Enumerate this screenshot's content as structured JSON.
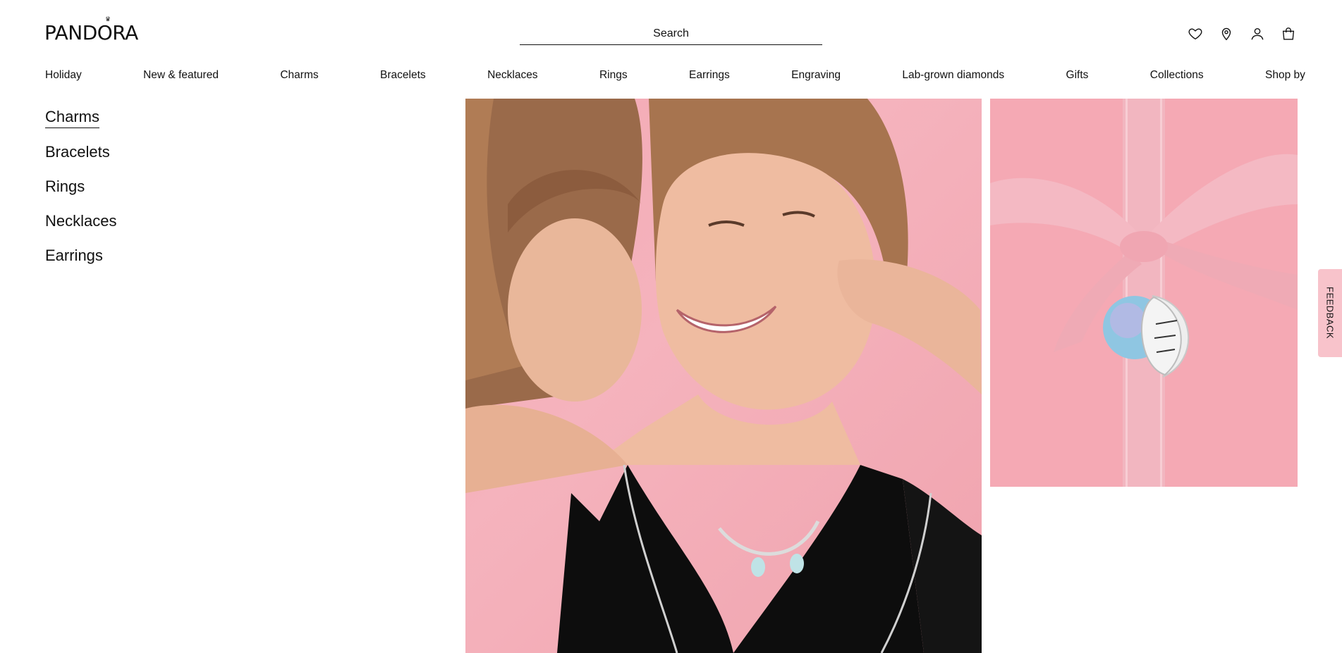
{
  "header": {
    "logo": "PANDORA",
    "search_placeholder": "Search",
    "icons": [
      "heart-icon",
      "location-pin-icon",
      "user-icon",
      "shopping-bag-icon"
    ]
  },
  "nav": {
    "items": [
      "Holiday",
      "New & featured",
      "Charms",
      "Bracelets",
      "Necklaces",
      "Rings",
      "Earrings",
      "Engraving",
      "Lab-grown diamonds",
      "Gifts",
      "Collections",
      "Shop by"
    ]
  },
  "submenu": {
    "items": [
      "Charms",
      "Bracelets",
      "Rings",
      "Necklaces",
      "Earrings"
    ],
    "active": "Charms"
  },
  "feedback": {
    "label": "FEEDBACK"
  },
  "colors": {
    "pink_bg": "#f5a9b4",
    "feedback_tab": "#f8c3cb",
    "text": "#111111"
  }
}
